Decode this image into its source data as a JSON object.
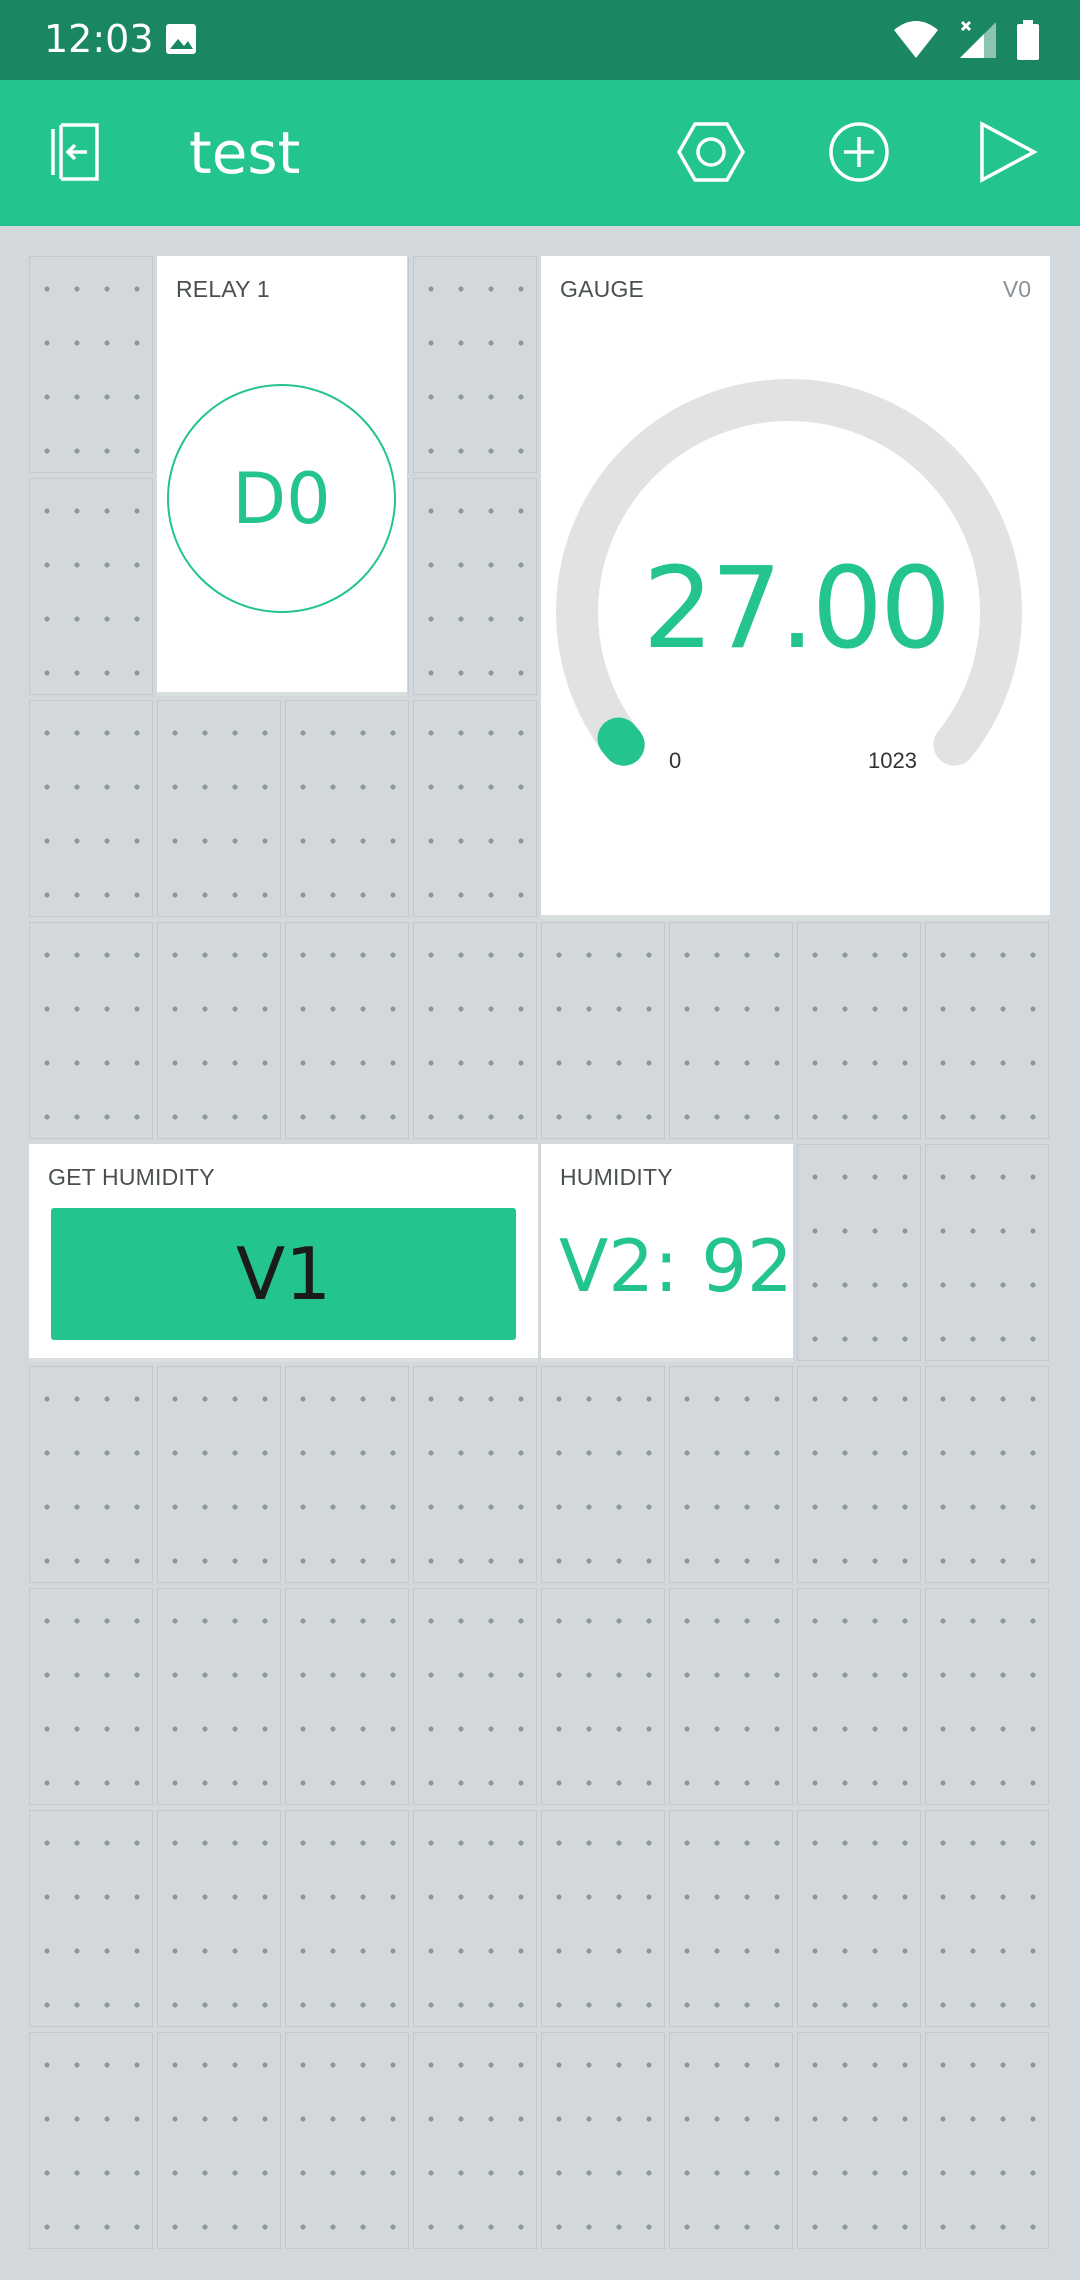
{
  "status_bar": {
    "time": "12:03",
    "icons": [
      "image-icon",
      "wifi-icon",
      "signal-icon",
      "battery-icon"
    ]
  },
  "app_bar": {
    "title": "test",
    "actions": [
      "exit-icon",
      "settings-icon",
      "add-widget-icon",
      "play-icon"
    ],
    "color": "#23C48E"
  },
  "widgets": {
    "relay": {
      "label": "RELAY 1",
      "pin": "D0"
    },
    "gauge": {
      "label": "GAUGE",
      "pin": "V0",
      "value": "27.00",
      "min": "0",
      "max": "1023"
    },
    "button": {
      "label": "GET HUMIDITY",
      "pin": "V1"
    },
    "display": {
      "label": "HUMIDITY",
      "value": "V2: 92"
    }
  }
}
